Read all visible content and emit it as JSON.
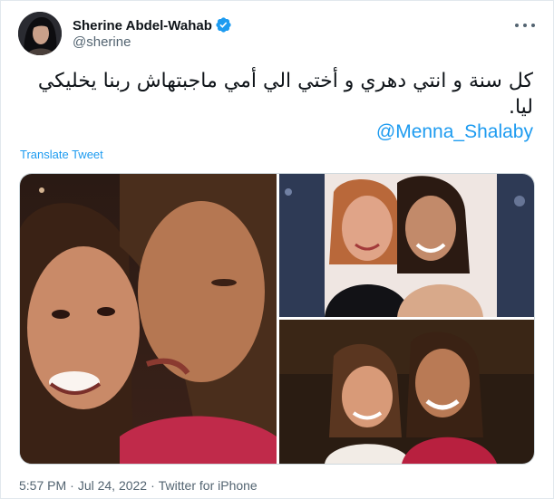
{
  "tweet": {
    "author": {
      "display_name": "Sherine Abdel-Wahab",
      "handle": "@sherine",
      "verified": true,
      "avatar_icon": "profile-photo"
    },
    "text": "كل سنة و انتي دهري و أختي الي أمي ماجبتهاش ربنا يخليكي ليا.",
    "mention": "@Menna_Shalaby",
    "translate_label": "Translate Tweet",
    "media": [
      {
        "description": "photo-1-two-women-cheek-kiss"
      },
      {
        "description": "photo-2-two-women-smiling-party"
      },
      {
        "description": "photo-3-two-women-smiling-night"
      }
    ],
    "time": "5:57 PM",
    "date": "Jul 24, 2022",
    "separator": "·",
    "source": "Twitter for iPhone"
  },
  "colors": {
    "accent": "#1d9bf0",
    "secondary_text": "#536471",
    "border": "#cfd9de"
  },
  "icons": {
    "verified": "verified-badge-icon",
    "more": "more-options-icon"
  }
}
